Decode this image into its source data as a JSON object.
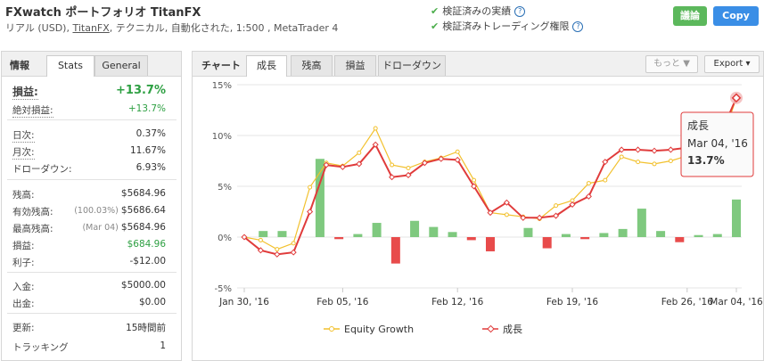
{
  "header": {
    "title": "FXwatch ポートフォリオ TitanFX",
    "subtitle_prefix": "リアル (USD), ",
    "subtitle_link": "TitanFX",
    "subtitle_suffix": ", テクニカル, 自動化された, 1:500 , MetaTrader 4",
    "verified_track": "検証済みの実績",
    "verified_trading": "検証済みトレーディング権限",
    "discuss_button": "議論",
    "copy_button": "Copy"
  },
  "stats_panel": {
    "label": "情報",
    "tabs": [
      "Stats",
      "General"
    ],
    "gain_label": "損益:",
    "gain_value": "+13.7%",
    "abs_gain_label": "絶対損益:",
    "abs_gain_value": "+13.7%",
    "daily_label": "日次:",
    "daily_value": "0.37%",
    "monthly_label": "月次:",
    "monthly_value": "11.67%",
    "drawdown_label": "ドローダウン:",
    "drawdown_value": "6.93%",
    "balance_label": "残高:",
    "balance_value": "$5684.96",
    "equity_label": "有効残高:",
    "equity_sub": "(100.03%)",
    "equity_value": "$5686.64",
    "highest_label": "最高残高:",
    "highest_sub": "(Mar 04)",
    "highest_value": "$5684.96",
    "profit_label": "損益:",
    "profit_value": "$684.96",
    "interest_label": "利子:",
    "interest_value": "-$12.00",
    "deposits_label": "入金:",
    "deposits_value": "$5000.00",
    "withdrawals_label": "出金:",
    "withdrawals_value": "$0.00",
    "updated_label": "更新:",
    "updated_value": "15時間前",
    "tracking_label": "トラッキング",
    "tracking_value": "1"
  },
  "chart_panel": {
    "label": "チャート",
    "tabs": [
      "成長",
      "残高",
      "損益",
      "ドローダウン"
    ],
    "more_button": "もっと ▼",
    "export_button": "Export",
    "tooltip": {
      "title": "成長",
      "date": "Mar 04, '16",
      "value": "13.7%"
    }
  },
  "chart_data": {
    "type": "line",
    "x": [
      "Jan 30, '16",
      "Jan 31",
      "Feb 01",
      "Feb 02",
      "Feb 03",
      "Feb 04",
      "Feb 05",
      "Feb 06",
      "Feb 07",
      "Feb 08",
      "Feb 09",
      "Feb 10",
      "Feb 11",
      "Feb 12",
      "Feb 13",
      "Feb 14",
      "Feb 15",
      "Feb 16",
      "Feb 17",
      "Feb 18",
      "Feb 19",
      "Feb 20",
      "Feb 21",
      "Feb 22",
      "Feb 23",
      "Feb 24",
      "Feb 25",
      "Feb 26",
      "Feb 27",
      "Feb 28",
      "Mar 04, '16"
    ],
    "x_ticks": [
      "Jan 30, '16",
      "Feb 05, '16",
      "Feb 12, '16",
      "Feb 19, '16",
      "Feb 26, '16",
      "Mar 04, '16"
    ],
    "ylim": [
      -5,
      15
    ],
    "yticks": [
      "15%",
      "10%",
      "5%",
      "0%",
      "-5%"
    ],
    "grid": true,
    "legend_position": "bottom",
    "series": [
      {
        "name": "Equity Growth",
        "type": "line",
        "color": "#f2c12e",
        "values": [
          0,
          -0.3,
          -1.2,
          -0.6,
          4.9,
          7.3,
          7.0,
          8.3,
          10.7,
          7.1,
          6.8,
          7.4,
          7.8,
          8.4,
          5.6,
          2.4,
          2.2,
          2.0,
          1.8,
          3.1,
          3.6,
          5.3,
          5.6,
          7.9,
          7.4,
          7.2,
          7.5,
          8.0,
          8.4,
          8.9,
          13.7
        ]
      },
      {
        "name": "成長",
        "type": "line",
        "color": "#e03b3b",
        "values": [
          0,
          -1.3,
          -1.7,
          -1.5,
          2.5,
          7.1,
          6.9,
          7.2,
          9.1,
          5.9,
          6.1,
          7.3,
          7.7,
          7.6,
          5.0,
          2.4,
          3.4,
          1.9,
          1.9,
          2.1,
          3.2,
          4.0,
          7.4,
          8.6,
          8.6,
          8.5,
          8.6,
          8.8,
          9.0,
          10.0,
          13.7
        ]
      },
      {
        "name": "",
        "type": "bar",
        "values": [
          0,
          0.6,
          0.6,
          0,
          7.7,
          -0.2,
          0.3,
          1.4,
          -2.6,
          1.6,
          1.0,
          0.5,
          -0.3,
          -1.4,
          0,
          0.9,
          -1.1,
          0.3,
          -0.2,
          0.4,
          0.8,
          2.8,
          0.6,
          -0.5,
          0.2,
          0.3,
          3.7
        ]
      }
    ]
  }
}
